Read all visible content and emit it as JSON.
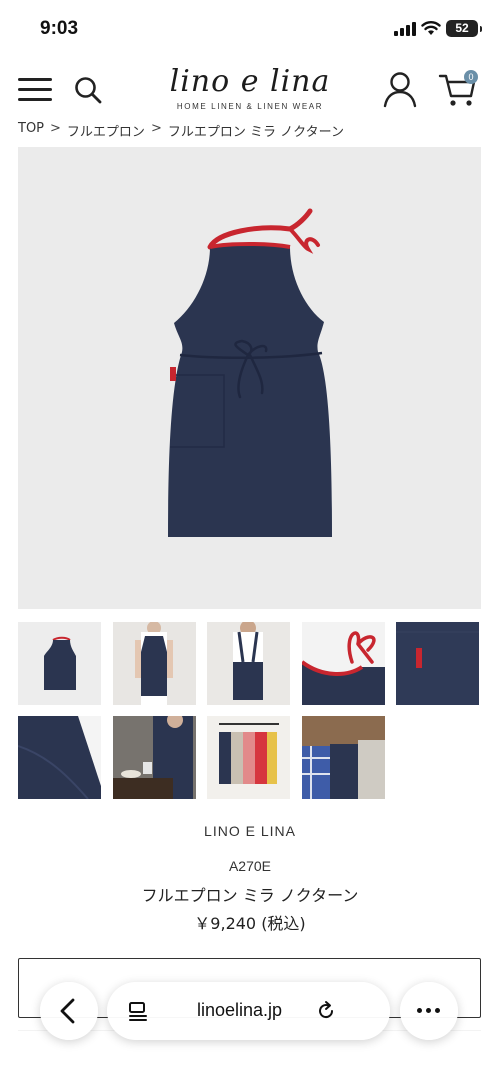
{
  "status_bar": {
    "time": "9:03",
    "battery": "52"
  },
  "header": {
    "logo_main": "lino e lina",
    "logo_sub": "HOME LINEN & LINEN WEAR",
    "cart_count": "0"
  },
  "breadcrumb": {
    "items": [
      "TOP",
      "フルエプロン",
      "フルエプロン ミラ ノクターン"
    ],
    "separator": ">"
  },
  "product": {
    "brand": "LINO E LINA",
    "sku": "A270E",
    "name": "フルエプロン ミラ ノクターン",
    "price": "￥9,240 (税込)"
  },
  "colors": {
    "apron_navy": "#2b3550",
    "strap_red": "#c8262f",
    "cart_badge": "#6a8fa8"
  },
  "browser": {
    "url": "linoelina.jp"
  },
  "icons": [
    "menu-icon",
    "search-icon",
    "user-icon",
    "cart-icon",
    "back-icon",
    "tab-overview-icon",
    "reload-icon",
    "more-icon"
  ]
}
